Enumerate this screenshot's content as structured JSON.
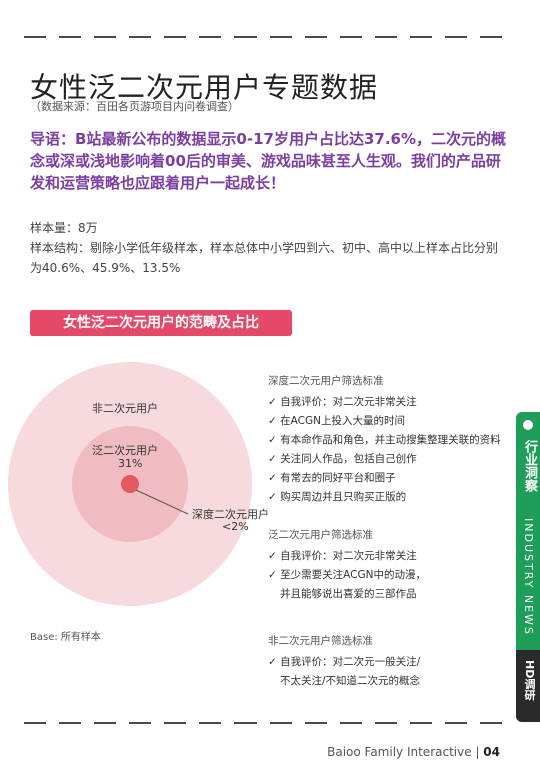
{
  "header": {
    "title": "女性泛二次元用户专题数据",
    "source": "（数据来源：百田各页游项目内问卷调查）"
  },
  "intro": "导语：B站最新公布的数据显示0-17岁用户占比达37.6%，二次元的概念或深或浅地影响着00后的审美、游戏品味甚至人生观。我们的产品研发和运营策略也应跟着用户一起成长！",
  "meta": {
    "sample_size": "样本量：8万",
    "sample_structure": "样本结构：剔除小学低年级样本，样本总体中小学四到六、初中、高中以上样本占比分别为40.6%、45.9%、13.5%"
  },
  "section_tag": "女性泛二次元用户的范畴及占比",
  "chart_data": {
    "type": "nested-circles",
    "segments": [
      {
        "label": "非二次元用户",
        "value_text": ""
      },
      {
        "label": "泛二次元用户",
        "value_text": "31%"
      },
      {
        "label": "深度二次元用户",
        "value_text": "<2%"
      }
    ],
    "colors": {
      "outer": "#f7dadd",
      "middle": "#f0bcc2",
      "inner": "#e05a5f"
    }
  },
  "criteria": [
    {
      "head": "深度二次元用户筛选标准",
      "items": [
        {
          "text": "自我评价：对二次元非常关注"
        },
        {
          "text": "在ACGN上投入大量的时间"
        },
        {
          "text": "有本命作品和角色，并主动搜集整理关联的资料"
        },
        {
          "text": "关注同人作品，包括自己创作"
        },
        {
          "text": "有常去的同好平台和圈子"
        },
        {
          "text": "购买周边并且只购买正版的"
        }
      ]
    },
    {
      "head": "泛二次元用户筛选标准",
      "items": [
        {
          "text": "自我评价：对二次元非常关注"
        },
        {
          "text": "至少需要关注ACGN中的动漫，",
          "cont": "并且能够说出喜爱的三部作品"
        }
      ]
    },
    {
      "head": "非二次元用户筛选标准",
      "items": [
        {
          "text": "自我评价：对二次元一般关注/",
          "cont": "不太关注/不知道二次元的概念"
        }
      ]
    }
  ],
  "base_note": "Base: 所有样本",
  "side": {
    "tab_cn": "行业洞察",
    "tab_en": "INDUSTRY NEWS",
    "tab_small": "HD调研"
  },
  "footer": {
    "company": "Baioo Family Interactive",
    "page": "04"
  }
}
